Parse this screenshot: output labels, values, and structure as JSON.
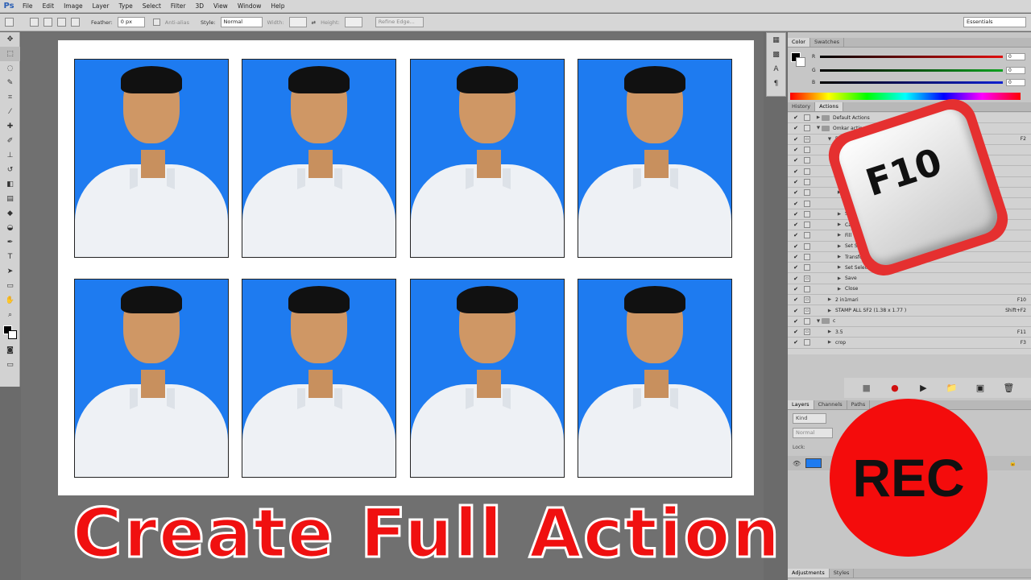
{
  "app": {
    "logo": "Ps"
  },
  "menu": [
    "File",
    "Edit",
    "Image",
    "Layer",
    "Type",
    "Select",
    "Filter",
    "3D",
    "View",
    "Window",
    "Help"
  ],
  "options_bar": {
    "feather_label": "Feather:",
    "feather_value": "0 px",
    "antialias_label": "Anti-alias",
    "style_label": "Style:",
    "style_value": "Normal",
    "width_label": "Width:",
    "height_label": "Height:",
    "refine_label": "Refine Edge...",
    "workspace": "Essentials"
  },
  "color_panel": {
    "tabs": [
      "Color",
      "Swatches"
    ],
    "channels": [
      {
        "label": "R",
        "value": "0",
        "color": "#e01010"
      },
      {
        "label": "G",
        "value": "0",
        "color": "#10a020"
      },
      {
        "label": "B",
        "value": "0",
        "color": "#1020d0"
      }
    ]
  },
  "actions_panel": {
    "tabs": [
      "History",
      "Actions"
    ],
    "rows": [
      {
        "check": "✔",
        "modal": "",
        "tri": "▶",
        "folder": true,
        "name": "Default Actions",
        "key": ""
      },
      {
        "check": "✔",
        "modal": "",
        "tri": "▼",
        "folder": true,
        "name": "Omkar actions",
        "key": ""
      },
      {
        "check": "✔",
        "modal": "▭",
        "tri": "▼",
        "folder": false,
        "name": "P P  ALL ...",
        "key": "F2"
      },
      {
        "check": "✔",
        "modal": "",
        "tri": "▶",
        "folder": false,
        "name": "",
        "key": ""
      },
      {
        "check": "✔",
        "modal": "",
        "tri": "▶",
        "folder": false,
        "name": "",
        "key": ""
      },
      {
        "check": "✔",
        "modal": "",
        "tri": "▶",
        "folder": false,
        "name": "S",
        "key": ""
      },
      {
        "check": "✔",
        "modal": "",
        "tri": "▶",
        "folder": false,
        "name": "C",
        "key": ""
      },
      {
        "check": "✔",
        "modal": "",
        "tri": "▶",
        "folder": false,
        "name": "Set",
        "key": ""
      },
      {
        "check": "✔",
        "modal": "",
        "tri": "",
        "folder": false,
        "name": "Defi",
        "key": ""
      },
      {
        "check": "✔",
        "modal": "",
        "tri": "▶",
        "folder": false,
        "name": "Set S",
        "key": ""
      },
      {
        "check": "✔",
        "modal": "",
        "tri": "▶",
        "folder": false,
        "name": "Canvas",
        "key": ""
      },
      {
        "check": "✔",
        "modal": "",
        "tri": "▶",
        "folder": false,
        "name": "Fill",
        "key": ""
      },
      {
        "check": "✔",
        "modal": "",
        "tri": "▶",
        "folder": false,
        "name": "Set Select",
        "key": ""
      },
      {
        "check": "✔",
        "modal": "",
        "tri": "▶",
        "folder": false,
        "name": "Transform c",
        "key": ""
      },
      {
        "check": "✔",
        "modal": "",
        "tri": "▶",
        "folder": false,
        "name": "Set Selection",
        "key": ""
      },
      {
        "check": "✔",
        "modal": "▭",
        "tri": "▶",
        "folder": false,
        "name": "Save",
        "key": ""
      },
      {
        "check": "✔",
        "modal": "",
        "tri": "▶",
        "folder": false,
        "name": "Close",
        "key": ""
      },
      {
        "check": "✔",
        "modal": "▭",
        "tri": "▶",
        "folder": false,
        "name": "2 in1mari",
        "key": "F10"
      },
      {
        "check": "✔",
        "modal": "▭",
        "tri": "▶",
        "folder": false,
        "name": "STAMP ALL SF2 (1.38  x 1.77 )",
        "key": "Shift+F2"
      },
      {
        "check": "✔",
        "modal": "",
        "tri": "▼",
        "folder": true,
        "name": "c",
        "key": ""
      },
      {
        "check": "✔",
        "modal": "▭",
        "tri": "▶",
        "folder": false,
        "name": "3.5",
        "key": "F11"
      },
      {
        "check": "✔",
        "modal": "",
        "tri": "▶",
        "folder": false,
        "name": "crop",
        "key": "F3"
      }
    ],
    "toolbar": [
      "■",
      "●",
      "▶",
      "📁",
      "▣",
      "🗑"
    ]
  },
  "layers_panel": {
    "tabs": [
      "Layers",
      "Channels",
      "Paths"
    ],
    "kind_label": "Kind",
    "blend_value": "Normal",
    "lock_label": "Lock:"
  },
  "bottom_tabs": [
    "Adjustments",
    "Styles"
  ],
  "overlay": {
    "f10_key": "F10",
    "rec_label": "REC",
    "headline": "Create Full Action"
  },
  "photo_grid": {
    "rows": 2,
    "cols": 4,
    "background": "#1e7bf0"
  }
}
